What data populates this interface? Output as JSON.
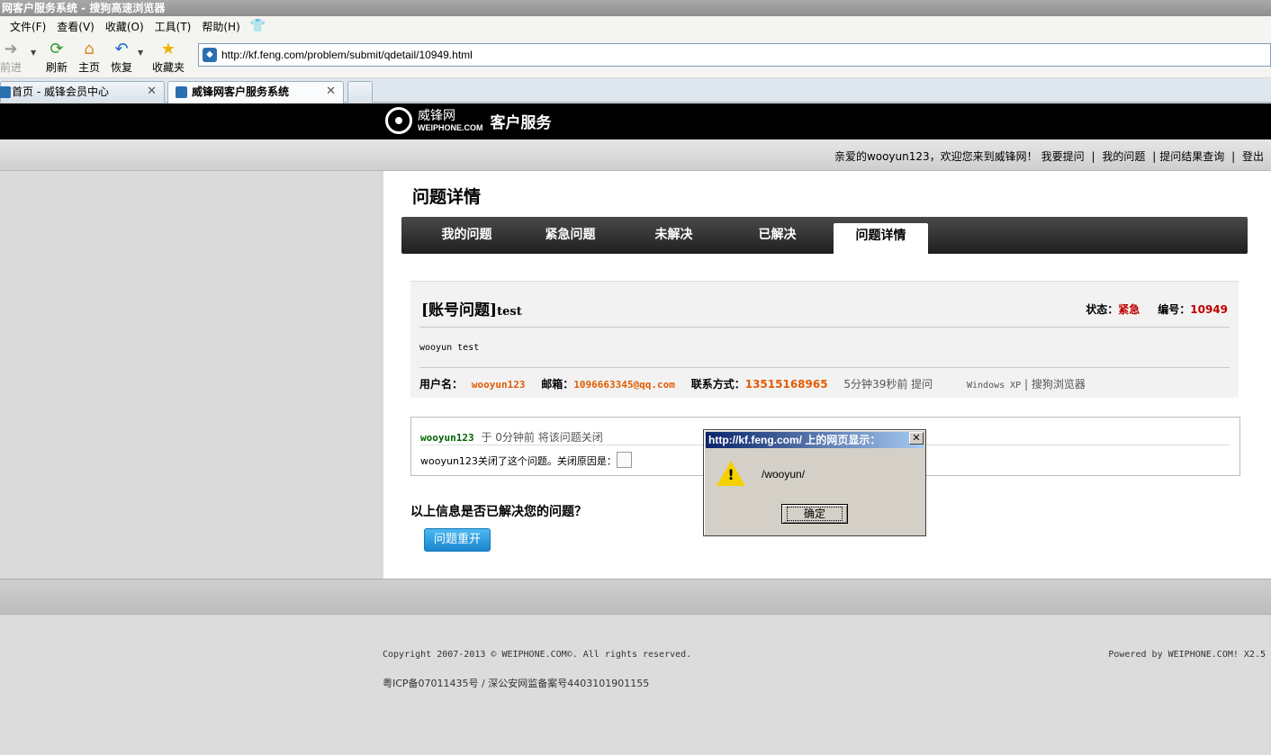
{
  "browser": {
    "window_title": "网客户服务系统 - 搜狗高速浏览器",
    "menu": [
      "文件(F)",
      "查看(V)",
      "收藏(O)",
      "工具(T)",
      "帮助(H)"
    ],
    "toolbar": {
      "back": "前进",
      "refresh": "刷新",
      "home": "主页",
      "restore": "恢复",
      "favorites": "收藏夹"
    },
    "address_url": "http://kf.feng.com/problem/submit/qdetail/10949.html",
    "tabs": [
      {
        "label": "首页 - 威锋会员中心",
        "active": false
      },
      {
        "label": "威锋网客户服务系统",
        "active": true
      }
    ]
  },
  "site": {
    "logo_cn": "威锋网",
    "logo_en": "WEIPHONE.COM",
    "service": "客户服务",
    "userbar": {
      "welcome": "亲爱的wooyun123，欢迎您来到威锋网！",
      "links": [
        "我要提问",
        "我的问题",
        "提问结果查询",
        "登出"
      ]
    }
  },
  "main": {
    "page_title": "问题详情",
    "nav_tabs": [
      "我的问题",
      "紧急问题",
      "未解决",
      "已解决",
      "问题详情"
    ],
    "active_tab": "问题详情",
    "question": {
      "category": "[账号问题]",
      "title": "test",
      "status_label": "状态：",
      "status": "紧急",
      "id_label": "编号：",
      "id": "10949",
      "body": "wooyun test",
      "username_label": "用户名：",
      "username": "wooyun123",
      "email_label": "邮箱：",
      "email": "1096663345@qq.com",
      "contact_label": "联系方式：",
      "contact": "13515168965",
      "time": "5分钟39秒前 提问",
      "os": "Windows XP",
      "browser_name": "搜狗浏览器"
    },
    "close_record": {
      "user": "wooyun123",
      "text": "于 0分钟前 将该问题关闭",
      "reason": "wooyun123关闭了这个问题。关闭原因是："
    },
    "resolve_question": "以上信息是否已解决您的问题？",
    "reopen_button": "问题重开"
  },
  "footer": {
    "copyright": "Copyright 2007-2013 © WEIPHONE.COM©. All rights reserved.",
    "icp": "粤ICP备07011435号 / 深公安网监备案号4403101901155",
    "powered": "Powered by WEIPHONE.COM! X2.5"
  },
  "dialog": {
    "title": "http://kf.feng.com/ 上的网页显示：",
    "message": "/wooyun/",
    "ok": "确定"
  }
}
